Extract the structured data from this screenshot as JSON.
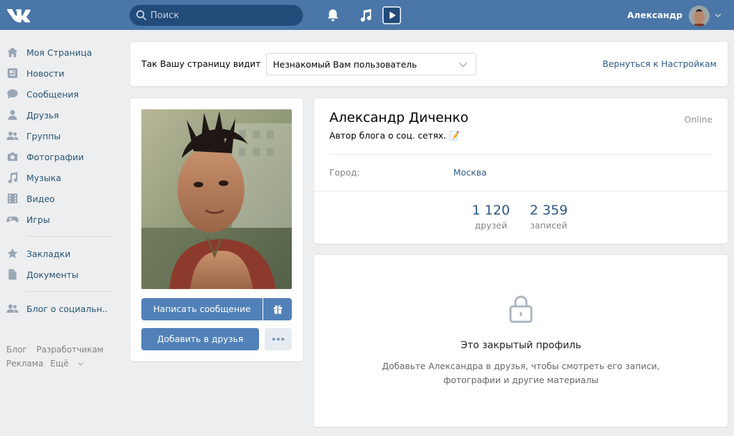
{
  "header": {
    "search_placeholder": "Поиск",
    "user_name": "Александр"
  },
  "nav": {
    "items": [
      {
        "label": "Моя Страница",
        "icon": "home-icon"
      },
      {
        "label": "Новости",
        "icon": "news-icon"
      },
      {
        "label": "Сообщения",
        "icon": "messages-icon"
      },
      {
        "label": "Друзья",
        "icon": "friends-icon"
      },
      {
        "label": "Группы",
        "icon": "groups-icon"
      },
      {
        "label": "Фотографии",
        "icon": "camera-icon"
      },
      {
        "label": "Музыка",
        "icon": "music-icon"
      },
      {
        "label": "Видео",
        "icon": "video-icon"
      },
      {
        "label": "Игры",
        "icon": "gamepad-icon"
      },
      {
        "label": "Закладки",
        "icon": "star-icon"
      },
      {
        "label": "Документы",
        "icon": "document-icon"
      },
      {
        "label": "Блог о социальн..",
        "icon": "community-icon"
      }
    ],
    "footer": [
      "Блог",
      "Разработчикам",
      "Реклама",
      "Ещё"
    ]
  },
  "view_bar": {
    "label": "Так Вашу страницу видит",
    "selected": "Незнакомый Вам пользователь",
    "back_link": "Вернуться к Настройкам"
  },
  "profile": {
    "message_button": "Написать сообщение",
    "add_friend_button": "Добавить в друзья",
    "name": "Александр Диченко",
    "status": "Автор блога о соц. сетях. 📝",
    "online": "Online",
    "city_label": "Город:",
    "city_value": "Москва",
    "counters": [
      {
        "num": "1 120",
        "label": "друзей"
      },
      {
        "num": "2 359",
        "label": "записей"
      }
    ]
  },
  "closed": {
    "title": "Это закрытый профиль",
    "description": "Добавьте Александра в друзья, чтобы смотреть его записи, фотографии и другие материалы"
  },
  "colors": {
    "header_bg": "#4a76a8",
    "page_bg": "#edeef0",
    "button_bg": "#5181b8",
    "link": "#2a5885"
  }
}
